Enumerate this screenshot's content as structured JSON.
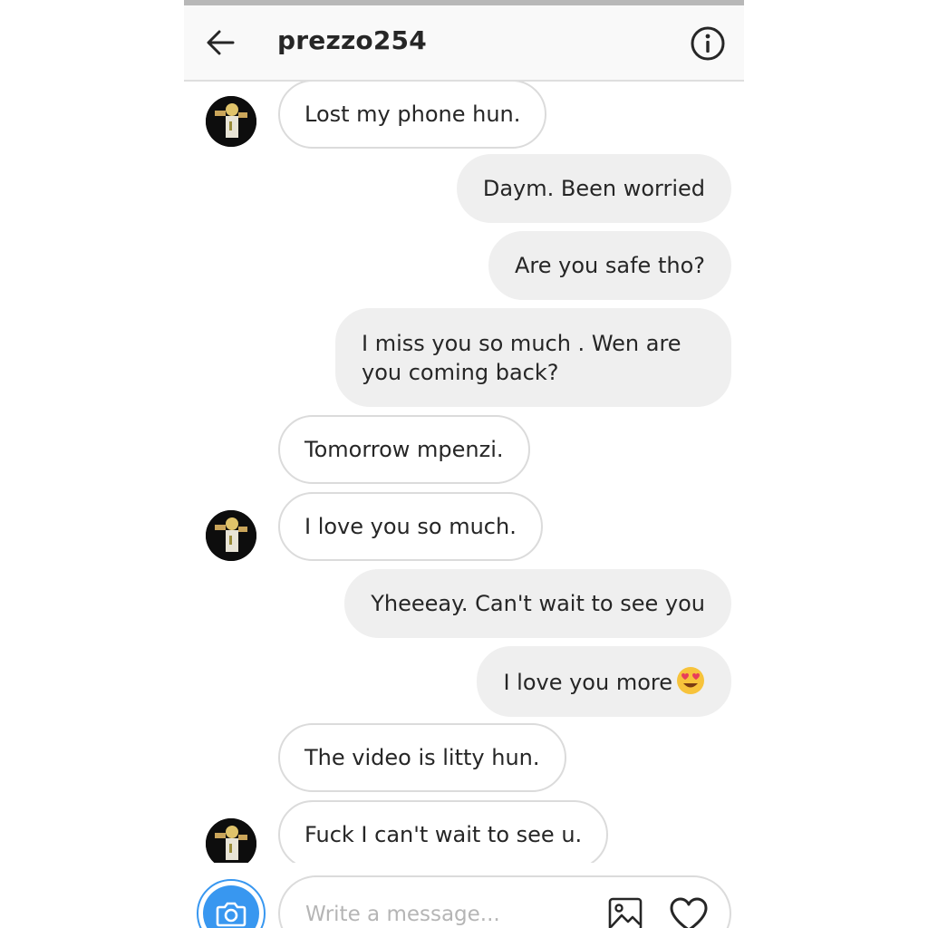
{
  "header": {
    "username": "prezzo254",
    "back_icon": "arrow-left-icon",
    "info_icon": "info-circle-icon"
  },
  "messages": [
    {
      "side": "in",
      "text": "Lost my phone hun.",
      "avatar": true
    },
    {
      "side": "out",
      "text": "Daym. Been worried"
    },
    {
      "side": "out",
      "text": "Are you safe tho?"
    },
    {
      "side": "out",
      "text": "I miss you so much . Wen are you coming back?"
    },
    {
      "side": "in",
      "text": "Tomorrow mpenzi."
    },
    {
      "side": "in",
      "text": "I love you so much.",
      "avatar": true
    },
    {
      "side": "out",
      "text": "Yheeeay. Can't wait to see you"
    },
    {
      "side": "out",
      "text": "I love you more",
      "emoji": "heart-eyes-emoji"
    },
    {
      "side": "in",
      "text": "The video is litty hun."
    },
    {
      "side": "in",
      "text": "Fuck I can't wait to see u.",
      "avatar": true
    }
  ],
  "composer": {
    "placeholder": "Write a message...",
    "camera_icon": "camera-icon",
    "gallery_icon": "image-icon",
    "like_icon": "heart-icon"
  },
  "colors": {
    "accent": "#3897f0",
    "incoming_bubble_border": "#dbdbdb",
    "outgoing_bubble_bg": "#efefef",
    "text": "#262626",
    "header_bg": "#f9f9f9"
  }
}
